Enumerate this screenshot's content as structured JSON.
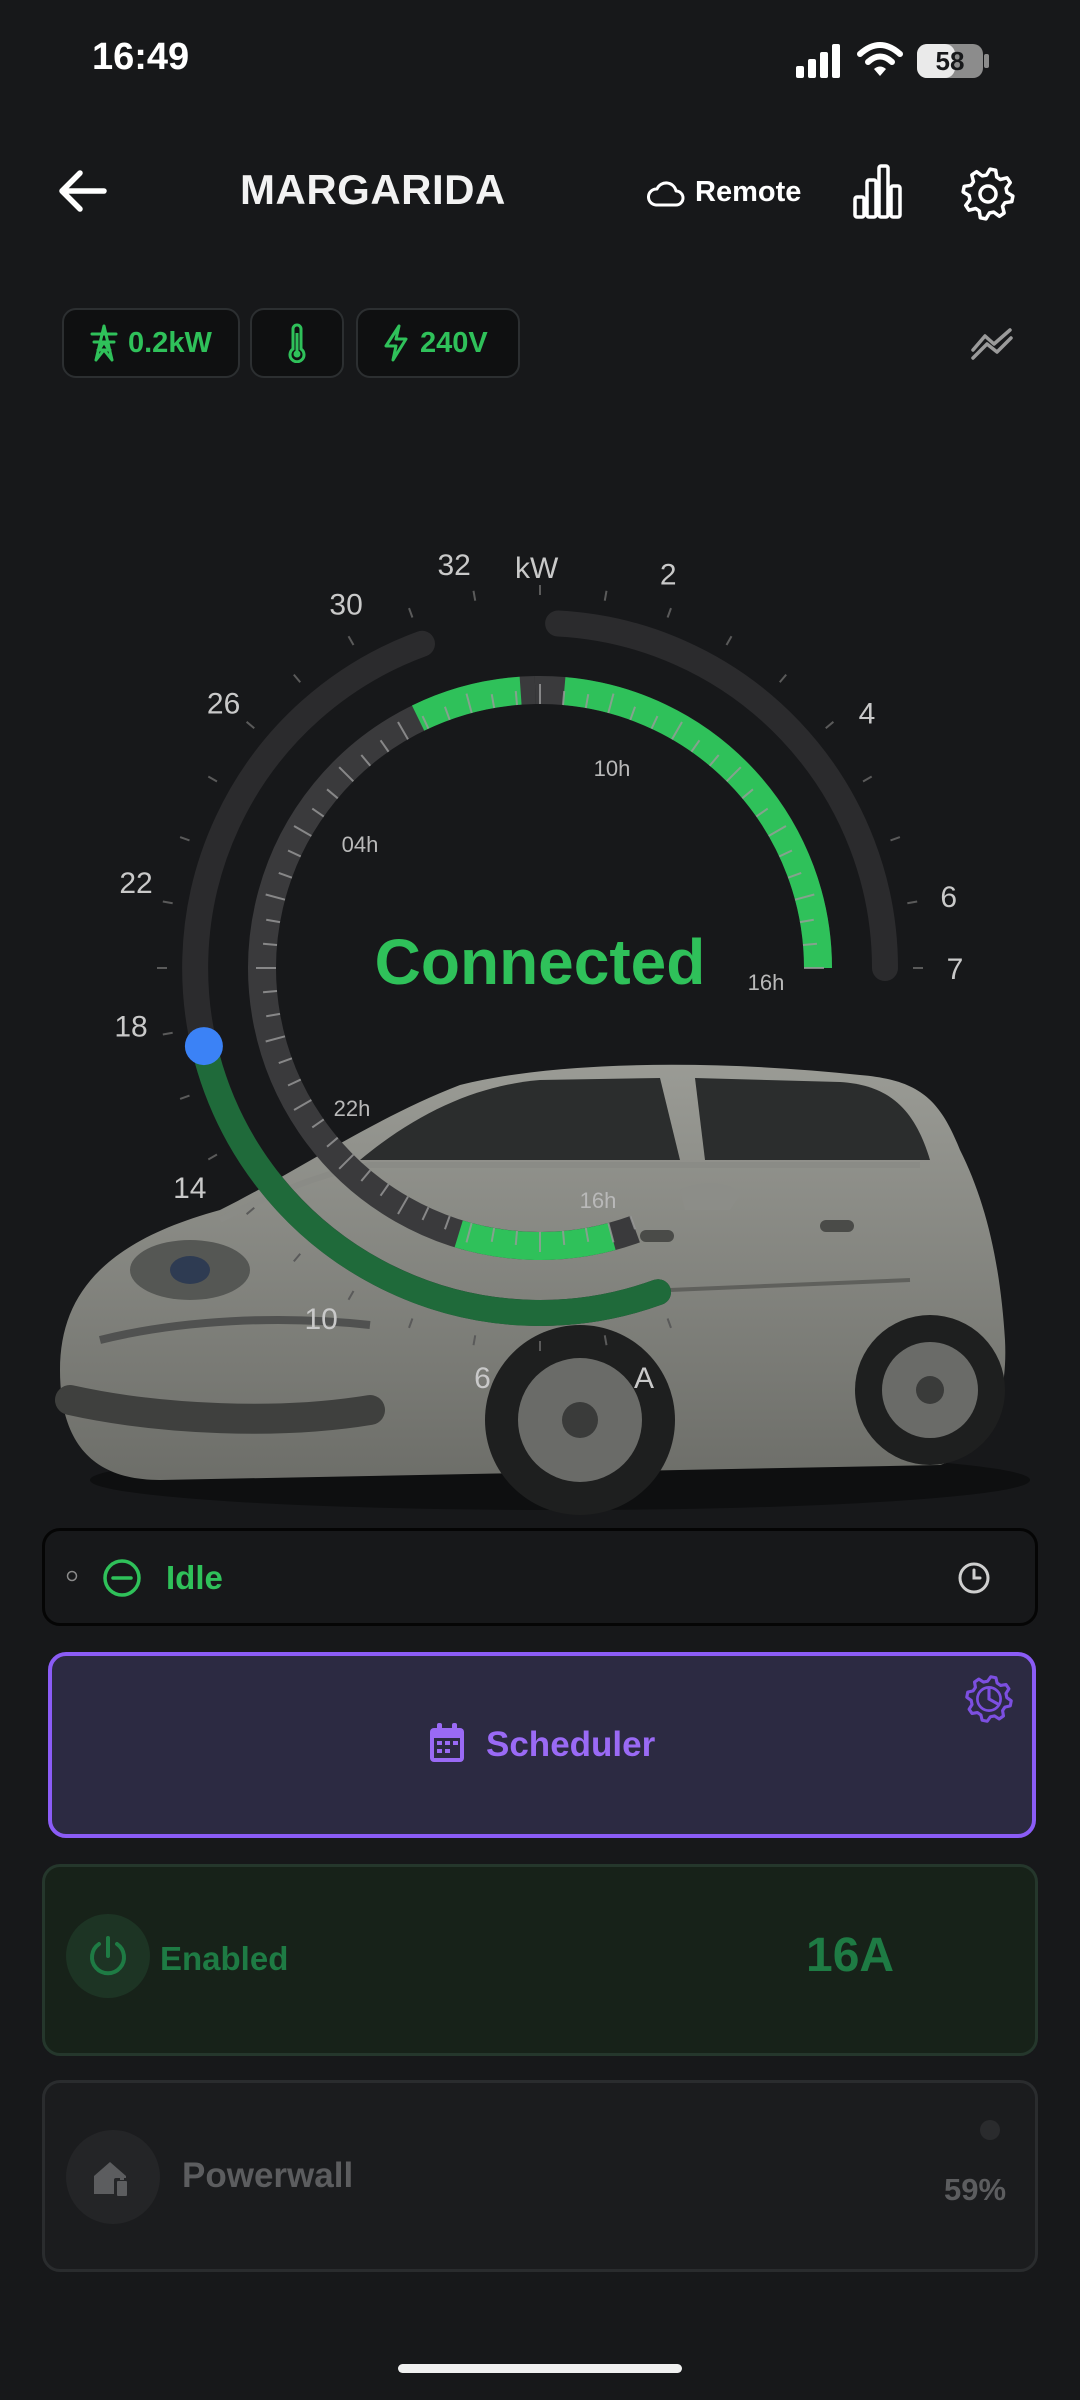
{
  "status_bar": {
    "time": "16:49",
    "battery_level": "58",
    "battery_fraction": 0.58,
    "icons": [
      "cellular-signal-icon",
      "wifi-icon",
      "battery-icon"
    ]
  },
  "header": {
    "back_icon": "arrow-left-icon",
    "title": "MARGARIDA",
    "connection_icon": "cloud-icon",
    "connection_label": "Remote",
    "stats_icon": "bar-chart-icon",
    "settings_icon": "gear-icon"
  },
  "chips": [
    {
      "icon": "power-tower-icon",
      "label": "0.2kW"
    },
    {
      "icon": "thermometer-icon",
      "label": ""
    },
    {
      "icon": "lightning-icon",
      "label": "240V"
    }
  ],
  "trend_icon": "trend-lines-icon",
  "gauge": {
    "status": "Connected",
    "power_unit": "kW",
    "power_ticks": [
      "2",
      "4",
      "6",
      "7"
    ],
    "current_unit": "A",
    "current_ticks": [
      "32",
      "30",
      "26",
      "22",
      "18",
      "14",
      "10",
      "6"
    ],
    "current_setpoint_amps": 20,
    "time_labels": [
      "10h",
      "04h",
      "16h",
      "22h",
      "16h"
    ],
    "colors": {
      "accent_green": "#2fc15a",
      "dark_green": "#1f6a3a",
      "track": "#2b2b2d",
      "setpoint": "#3b82f6"
    }
  },
  "vehicle_image": "car-illustration",
  "status_card": {
    "small_icon": "info-icon",
    "icon": "minus-circle-icon",
    "label": "Idle",
    "history_icon": "clock-icon"
  },
  "scheduler_card": {
    "icon": "calendar-icon",
    "label": "Scheduler",
    "settings_icon": "gear-icon",
    "accent": "#8b5cf6"
  },
  "enabled_card": {
    "icon": "power-icon",
    "label": "Enabled",
    "current": "16A"
  },
  "powerwall_card": {
    "icon": "home-battery-icon",
    "label": "Powerwall",
    "percent": "59%"
  }
}
